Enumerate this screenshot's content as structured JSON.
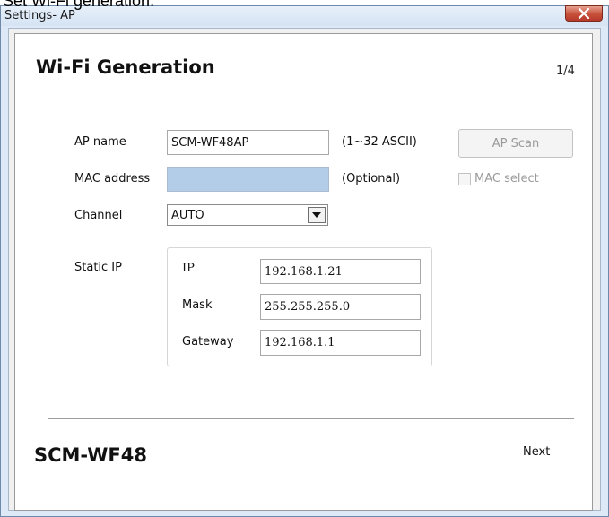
{
  "caption": "Set Wi-Fi generation:",
  "window": {
    "title": "Settings- AP"
  },
  "header": {
    "title": "Wi-Fi Generation",
    "page_indicator": "1/4"
  },
  "form": {
    "ap_name": {
      "label": "AP name",
      "value": "SCM-WF48AP",
      "hint": "(1~32 ASCII)"
    },
    "mac_address": {
      "label": "MAC address",
      "value": "",
      "hint": "(Optional)"
    },
    "channel": {
      "label": "Channel",
      "selected": "AUTO"
    },
    "ap_scan_label": "AP Scan",
    "mac_select_label": "MAC select",
    "static_ip": {
      "label": "Static IP",
      "ip": {
        "label": "IP",
        "value": "192.168.1.21"
      },
      "mask": {
        "label": "Mask",
        "value": "255.255.255.0"
      },
      "gateway": {
        "label": "Gateway",
        "value": "192.168.1.1"
      }
    }
  },
  "footer": {
    "brand": "SCM-WF48",
    "next_label": "Next"
  },
  "colors": {
    "mac_field_bg": "#b3cde9",
    "close_button": "#c7503a",
    "window_frame": "#dde9f6",
    "disabled_text": "#9a9a9a"
  },
  "icons": {
    "close": "close-icon",
    "dropdown": "chevron-down-icon"
  }
}
